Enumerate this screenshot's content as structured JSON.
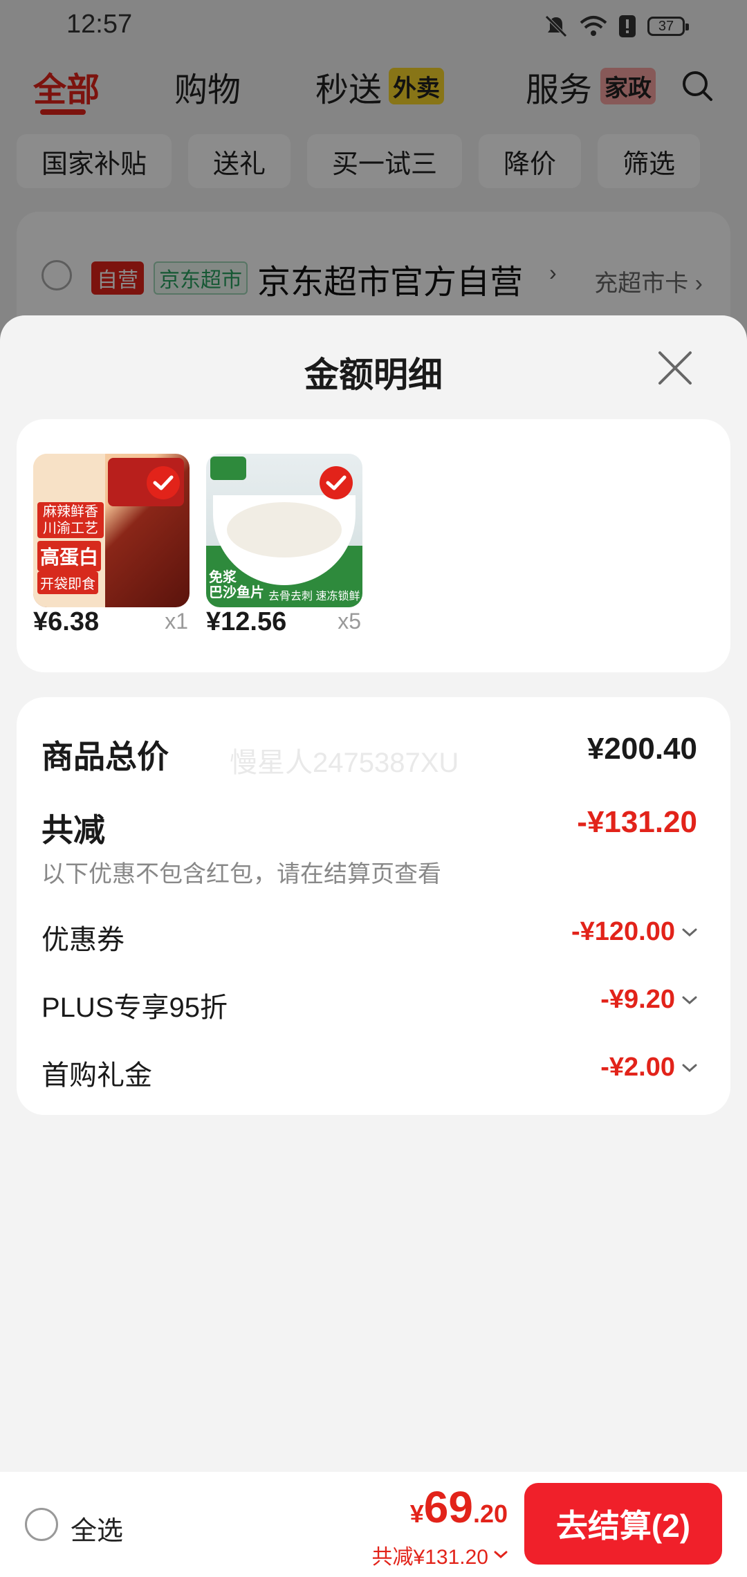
{
  "status_bar": {
    "time": "12:57",
    "battery": "37"
  },
  "top_tabs": {
    "all": "全部",
    "shopping": "购物",
    "express": "秒送",
    "express_badge": "外卖",
    "service": "服务",
    "service_badge": "家政"
  },
  "chips": [
    "国家补贴",
    "送礼",
    "买一试三",
    "降价",
    "筛选"
  ],
  "store": {
    "tag_self": "自营",
    "tag_super": "京东超市",
    "name": "京东超市官方自营",
    "arrow": "›",
    "card_link": "充超市卡 ›"
  },
  "sheet": {
    "title": "金额明细",
    "products": [
      {
        "price": "¥6.38",
        "qty": "x1"
      },
      {
        "price": "¥12.56",
        "qty": "x5"
      }
    ],
    "product_texts": {
      "p1_tag1": "麻辣鲜香",
      "p1_tag2": "川渝工艺",
      "p1_tag3": "高蛋白",
      "p1_tag4": "开袋即食",
      "p2_tag1": "免浆",
      "p2_tag2": "巴沙鱼片",
      "p2_tag3": "去骨去刺 速冻锁鲜"
    },
    "watermark": "慢星人2475387XU",
    "total_label": "商品总价",
    "total_value": "¥200.40",
    "discount_label": "共减",
    "discount_value": "-¥131.20",
    "discount_note": "以下优惠不包含红包，请在结算页查看",
    "items": [
      {
        "label": "优惠券",
        "value": "-¥120.00"
      },
      {
        "label": "PLUS专享95折",
        "value": "-¥9.20"
      },
      {
        "label": "首购礼金",
        "value": "-¥2.00"
      }
    ]
  },
  "bottom_bar": {
    "select_all": "全选",
    "currency": "¥",
    "total_int": "69",
    "total_dec": ".20",
    "discount": "共减¥131.20",
    "checkout": "去结算(2)"
  },
  "colors": {
    "accent": "#e2231a",
    "checkout": "#f0202a",
    "sheet_bg": "#f3f3f3"
  }
}
